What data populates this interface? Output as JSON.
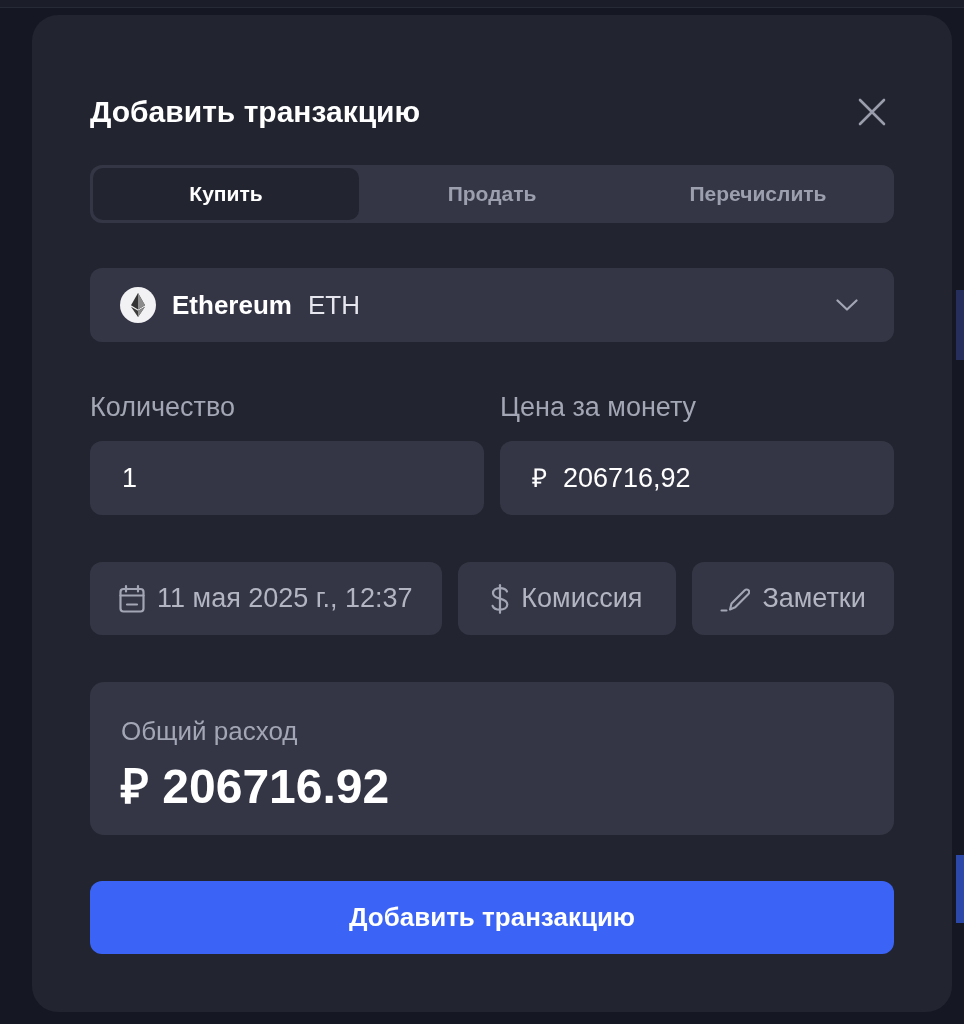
{
  "dialog": {
    "title": "Добавить транзакцию"
  },
  "tabs": [
    {
      "label": "Купить",
      "selected": true
    },
    {
      "label": "Продать",
      "selected": false
    },
    {
      "label": "Перечислить",
      "selected": false
    }
  ],
  "asset_select": {
    "name": "Ethereum",
    "symbol": "ETH"
  },
  "fields": [
    {
      "label": "Количество",
      "value": "1"
    },
    {
      "label": "Цена за монету",
      "currency": "₽",
      "value": "206716,92"
    }
  ],
  "chips": [
    {
      "kind": "date",
      "label": "11 мая 2025 г., 12:37"
    },
    {
      "kind": "fee",
      "label": "Комиссия"
    },
    {
      "kind": "notes",
      "label": "Заметки"
    }
  ],
  "total": {
    "label": "Общий расход",
    "value": "₽ 206716.92"
  },
  "submit_button": "Добавить транзакцию"
}
